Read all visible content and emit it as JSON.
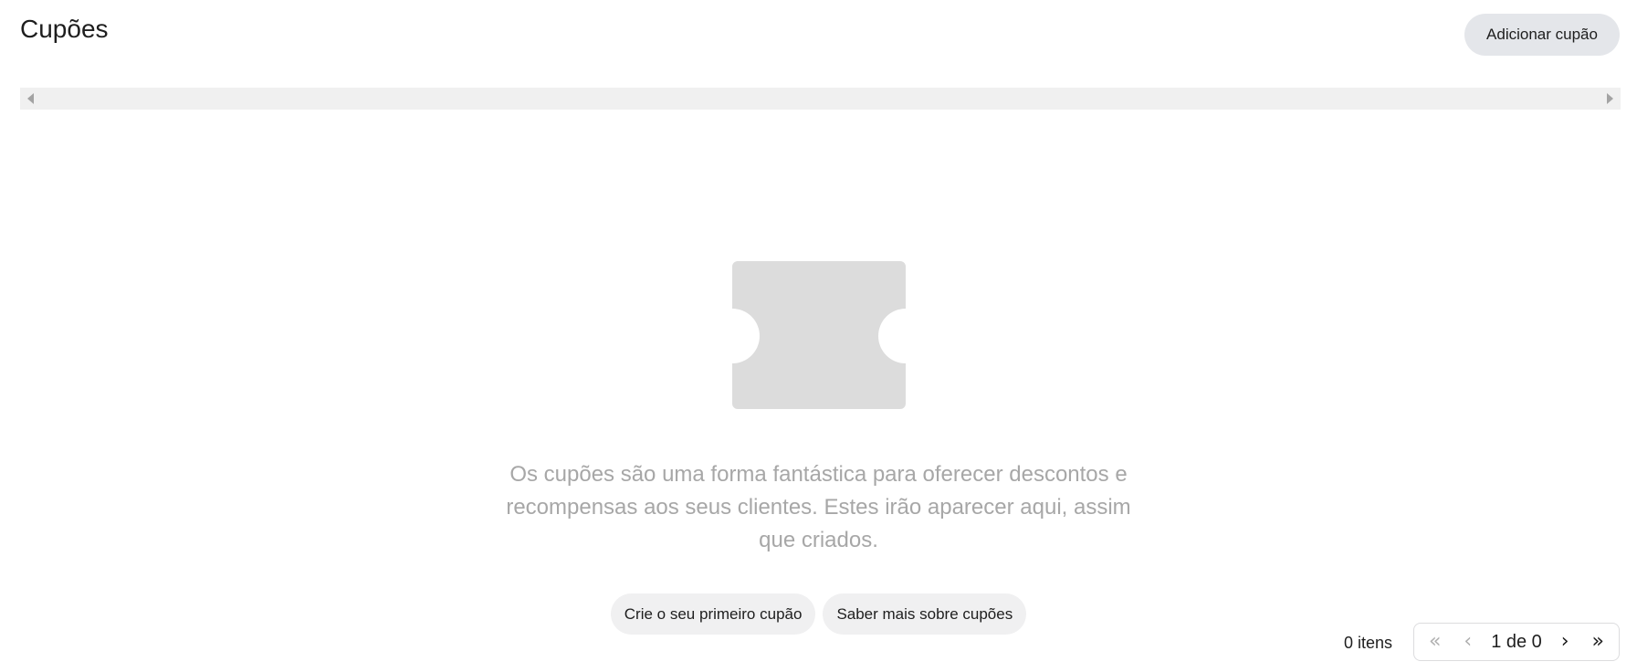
{
  "header": {
    "title": "Cupões",
    "add_button_label": "Adicionar cupão"
  },
  "empty_state": {
    "illustration": "coupon-icon",
    "message": "Os cupões são uma forma fantástica para oferecer descontos e recompensas aos seus clientes. Estes irão aparecer aqui, assim que criados.",
    "primary_action": "Crie o seu primeiro cupão",
    "secondary_action": "Saber mais sobre cupões"
  },
  "footer": {
    "items_count": "0 itens",
    "pagination": {
      "first": "«",
      "prev": "‹",
      "indicator": "1 de 0",
      "next": "›",
      "last": "»"
    }
  },
  "colors": {
    "illustration": "#dcdcdc",
    "message_text": "#a7a7a7",
    "primary_button_bg": "#e4e6ea",
    "secondary_button_bg": "#f0f0f1"
  }
}
